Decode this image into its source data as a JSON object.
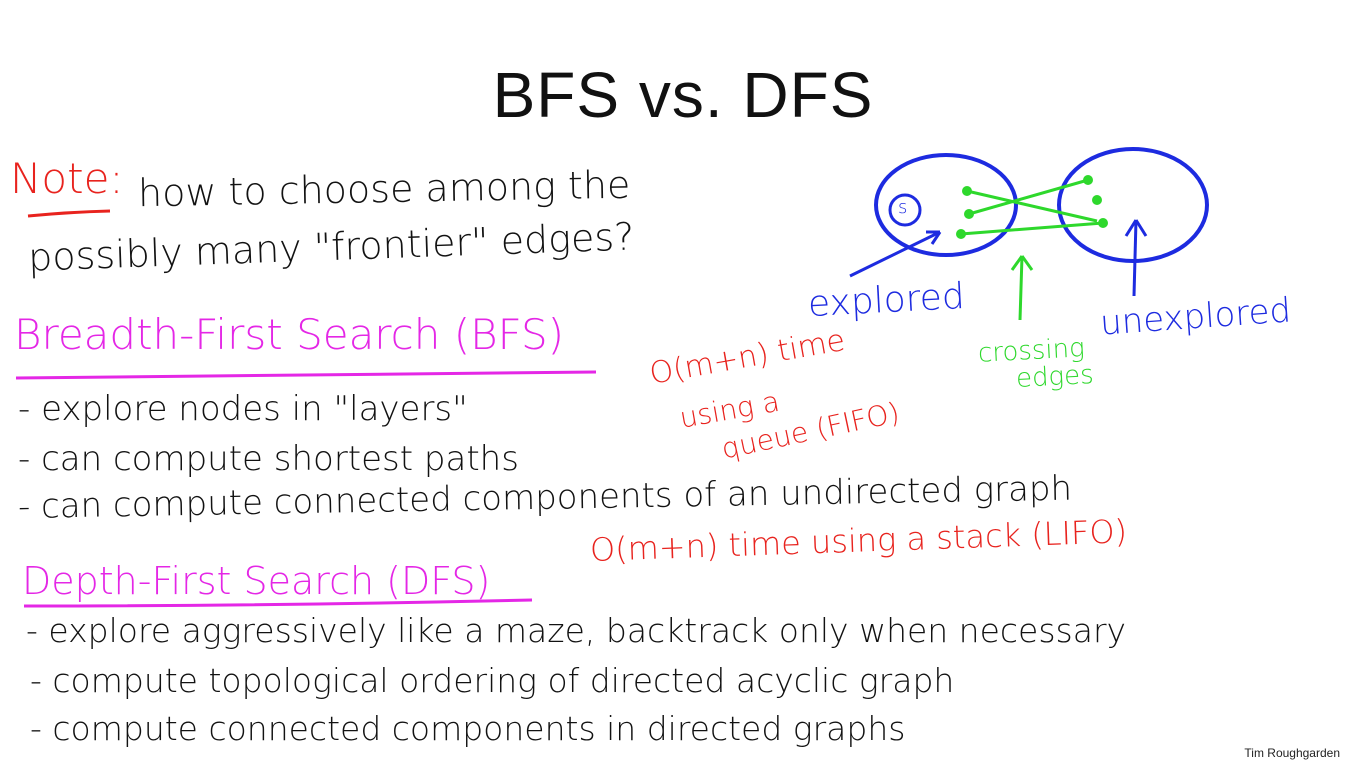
{
  "slide": {
    "title": "BFS vs. DFS",
    "credit": "Tim Roughgarden"
  },
  "note": {
    "label": "Note:",
    "line1": "how to choose among the",
    "line2": "possibly many \"frontier\" edges?"
  },
  "diagram": {
    "source_label": "s",
    "explored_label": "explored",
    "unexplored_label": "unexplored",
    "crossing_label_1": "crossing",
    "crossing_label_2": "edges"
  },
  "bfs": {
    "heading": "Breadth-First Search (BFS)",
    "bullets": [
      "- explore nodes in \"layers\"",
      "- can compute shortest paths",
      "- can compute connected components of an undirected graph"
    ],
    "runtime_line1": "O(m+n) time",
    "runtime_line2": "using a",
    "runtime_line3": "queue (FIFO)"
  },
  "dfs": {
    "heading": "Depth-First Search (DFS)",
    "runtime": "O(m+n) time using a stack (LIFO)",
    "bullets": [
      "- explore aggressively like a maze, backtrack only when necessary",
      "- compute topological ordering of directed acyclic graph",
      "- compute connected components in directed graphs"
    ]
  },
  "colors": {
    "note": "#e8231e",
    "bfs_heading": "#e427e6",
    "runtime": "#e8231e",
    "explored_region": "#1d2be0",
    "crossing_edges": "#2ed82c",
    "text": "#121212"
  }
}
